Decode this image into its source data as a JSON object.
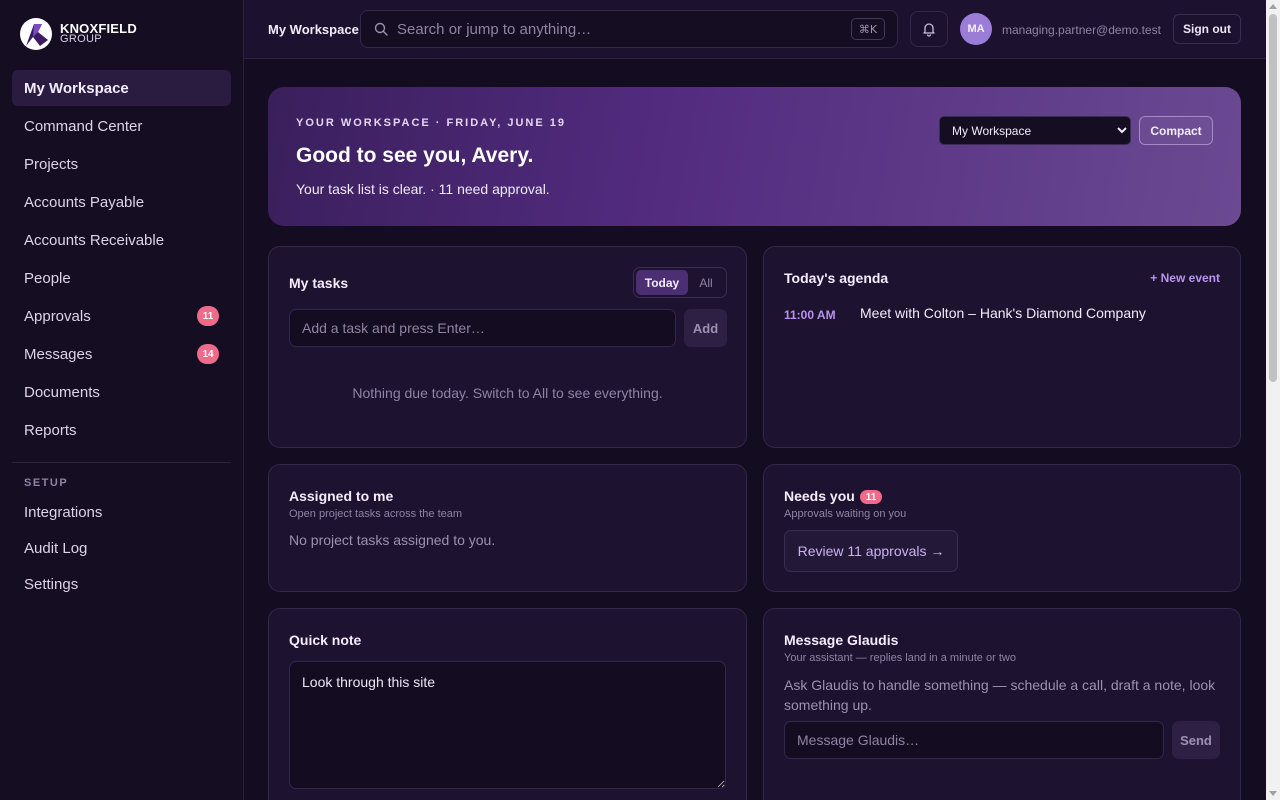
{
  "brand": {
    "line1": "KNOXFIELD",
    "line2": "GROUP"
  },
  "sidebar": {
    "items": [
      {
        "label": "My Workspace"
      },
      {
        "label": "Command Center"
      },
      {
        "label": "Projects"
      },
      {
        "label": "Accounts Payable"
      },
      {
        "label": "Accounts Receivable"
      },
      {
        "label": "People"
      },
      {
        "label": "Approvals",
        "badge": "11"
      },
      {
        "label": "Messages",
        "badge": "14"
      },
      {
        "label": "Documents"
      },
      {
        "label": "Reports"
      }
    ],
    "setup_label": "SETUP",
    "setup_items": [
      {
        "label": "Integrations"
      },
      {
        "label": "Audit Log"
      },
      {
        "label": "Settings"
      }
    ]
  },
  "topbar": {
    "title": "My Workspace",
    "search_placeholder": "Search or jump to anything…",
    "shortcut": "⌘K",
    "avatar_initials": "MA",
    "user_email": "managing.partner@demo.test",
    "signout_label": "Sign out"
  },
  "hero": {
    "eyebrow": "YOUR WORKSPACE · FRIDAY, JUNE 19",
    "title": "Good to see you, Avery.",
    "subtitle": "Your task list is clear. · 11 need approval.",
    "select_value": "My Workspace",
    "compact_label": "Compact"
  },
  "tasks": {
    "title": "My tasks",
    "tab_today": "Today",
    "tab_all": "All",
    "input_placeholder": "Add a task and press Enter…",
    "add_label": "Add",
    "empty": "Nothing due today. Switch to All to see everything."
  },
  "agenda": {
    "title": "Today's agenda",
    "new_event": "+ New event",
    "events": [
      {
        "time": "11:00 AM",
        "title": "Meet with Colton – Hank's Diamond Company"
      }
    ]
  },
  "assigned": {
    "title": "Assigned to me",
    "subtitle": "Open project tasks across the team",
    "empty": "No project tasks assigned to you."
  },
  "needs": {
    "title": "Needs you",
    "badge": "11",
    "subtitle": "Approvals waiting on you",
    "button": "Review 11 approvals →"
  },
  "note": {
    "title": "Quick note",
    "value": "Look through this site"
  },
  "glaudis": {
    "title": "Message Glaudis",
    "subtitle": "Your assistant — replies land in a minute or two",
    "body": "Ask Glaudis to handle something — schedule a call, draft a note, look something up.",
    "input_placeholder": "Message Glaudis…",
    "send_label": "Send"
  },
  "colors": {
    "accent": "#b893f0",
    "badge": "#f06a8a",
    "background": "#140c20",
    "card": "#1d1230"
  }
}
